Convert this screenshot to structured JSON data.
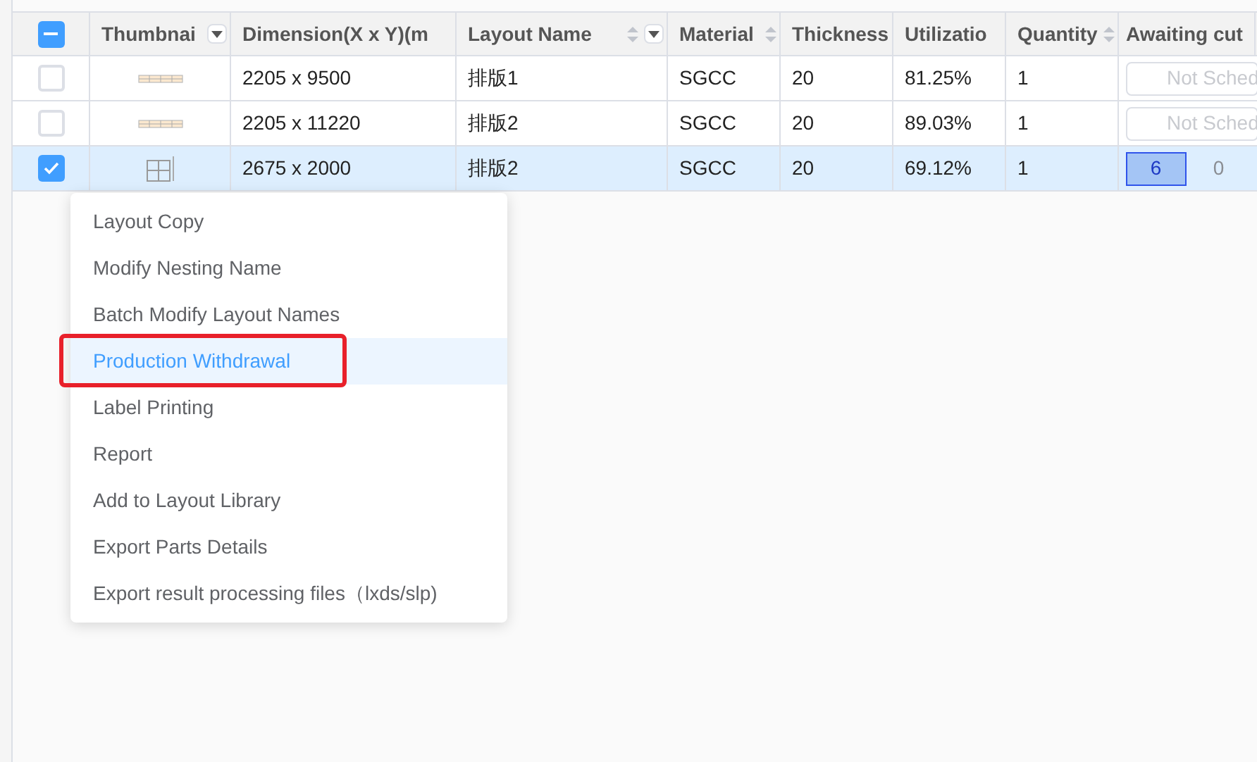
{
  "table": {
    "header_checkbox": {
      "indeterminate": true
    },
    "columns": [
      {
        "label": "Thumbnai",
        "sortable": false,
        "filter": true
      },
      {
        "label": "Dimension(X x Y)(m",
        "sortable": false,
        "filter": false
      },
      {
        "label": "Layout Name",
        "sortable": true,
        "filter": true
      },
      {
        "label": "Material",
        "sortable": true,
        "filter": false
      },
      {
        "label": "Thickness",
        "sortable": false,
        "filter": false
      },
      {
        "label": "Utilizatio",
        "sortable": false,
        "filter": false
      },
      {
        "label": "Quantity",
        "sortable": true,
        "filter": false
      },
      {
        "label": "Awaiting cut",
        "sortable": false,
        "filter": false
      }
    ],
    "rows": [
      {
        "selected": false,
        "dimension": "2205 x 9500",
        "layout_name": "排版1",
        "material": "SGCC",
        "thickness": "20",
        "utilization": "81.25%",
        "quantity": "1",
        "awaiting": {
          "kind": "field",
          "placeholder": "Not Sched"
        }
      },
      {
        "selected": false,
        "dimension": "2205 x 11220",
        "layout_name": "排版2",
        "material": "SGCC",
        "thickness": "20",
        "utilization": "89.03%",
        "quantity": "1",
        "awaiting": {
          "kind": "field",
          "placeholder": "Not Sched"
        }
      },
      {
        "selected": true,
        "dimension": "2675 x 2000",
        "layout_name": "排版2",
        "material": "SGCC",
        "thickness": "20",
        "utilization": "69.12%",
        "quantity": "1",
        "awaiting": {
          "kind": "counter",
          "values": [
            "6",
            "0"
          ]
        }
      }
    ]
  },
  "context_menu": {
    "items": [
      {
        "label": "Layout Copy",
        "selected": false,
        "outlined": false
      },
      {
        "label": "Modify Nesting Name",
        "selected": false,
        "outlined": false
      },
      {
        "label": "Batch Modify Layout Names",
        "selected": false,
        "outlined": false
      },
      {
        "label": "Production Withdrawal",
        "selected": true,
        "outlined": true
      },
      {
        "label": "Label Printing",
        "selected": false,
        "outlined": false
      },
      {
        "label": "Report",
        "selected": false,
        "outlined": false
      },
      {
        "label": "Add to Layout Library",
        "selected": false,
        "outlined": false
      },
      {
        "label": "Export Parts Details",
        "selected": false,
        "outlined": false
      },
      {
        "label": "Export result processing files（lxds/slp)",
        "selected": false,
        "outlined": false
      }
    ]
  }
}
